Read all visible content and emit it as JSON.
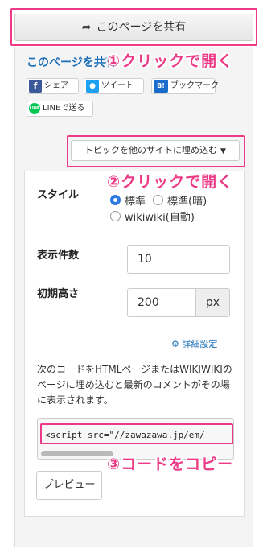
{
  "share_button": {
    "label": "このページを共有",
    "icon": "share-arrow-icon"
  },
  "section_title": "このページを共有",
  "sns": {
    "facebook_label": "シェア",
    "twitter_label": "ツイート",
    "hatena_label": "ブックマーク",
    "line_label": "LINEで送る"
  },
  "embed_dropdown": {
    "label": "トピックを他のサイトに埋め込む"
  },
  "form": {
    "style_label": "スタイル",
    "style_options": [
      {
        "label": "標準",
        "checked": true
      },
      {
        "label": "標準(暗)",
        "checked": false
      },
      {
        "label": "wikiwiki(自動)",
        "checked": false
      }
    ],
    "count_label": "表示件数",
    "count_value": "10",
    "height_label": "初期高さ",
    "height_value": "200",
    "height_unit": "px",
    "advanced_settings": "詳細設定",
    "description": "次のコードをHTMLページまたはWIKIWIKIのページに埋め込むと最新のコメントがその場に表示されます。",
    "code": "<script src=\"//zawazawa.jp/em/",
    "preview_button": "プレビュー"
  },
  "callouts": {
    "step1": "①クリックで開く",
    "step2": "②クリックで開く",
    "step3": "③コードをコピー"
  },
  "colors": {
    "accent": "#ec3a86",
    "link": "#1d6fb8",
    "radio": "#2a7ae2"
  }
}
